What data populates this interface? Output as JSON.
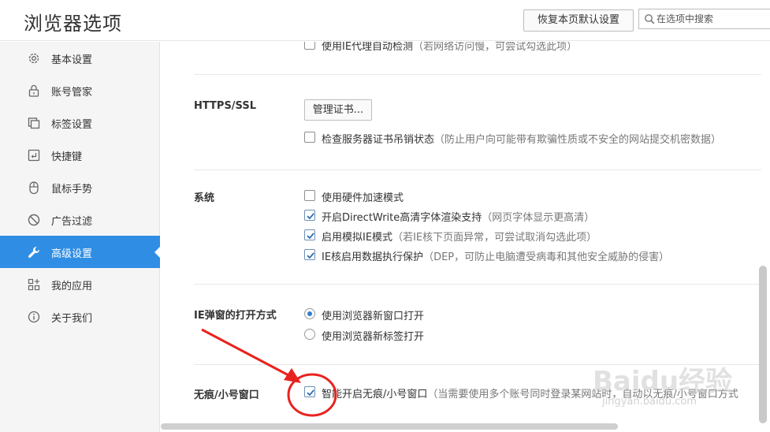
{
  "header": {
    "title": "浏览器选项",
    "reset_label": "恢复本页默认设置",
    "search_placeholder": "在选项中搜索"
  },
  "sidebar": {
    "items": [
      {
        "label": "基本设置",
        "icon": "gear-icon"
      },
      {
        "label": "账号管家",
        "icon": "lock-icon"
      },
      {
        "label": "标签设置",
        "icon": "tabs-icon"
      },
      {
        "label": "快捷键",
        "icon": "keyboard-icon"
      },
      {
        "label": "鼠标手势",
        "icon": "mouse-icon"
      },
      {
        "label": "广告过滤",
        "icon": "block-icon"
      },
      {
        "label": "高级设置",
        "icon": "wrench-icon",
        "active": true
      },
      {
        "label": "我的应用",
        "icon": "apps-icon"
      },
      {
        "label": "关于我们",
        "icon": "info-icon"
      }
    ],
    "active_color": "#2f8ee4"
  },
  "main": {
    "proxy": {
      "text": "使用IE代理自动检测",
      "hint": "（若网络访问慢，可尝试勾选此项）",
      "checked": false
    },
    "https": {
      "title": "HTTPS/SSL",
      "cert_button": "管理证书...",
      "check_revocation": {
        "text": "检查服务器证书吊销状态",
        "hint": "（防止用户向可能带有欺骗性质或不安全的网站提交机密数据）",
        "checked": false
      }
    },
    "system": {
      "title": "系统",
      "options": [
        {
          "text": "使用硬件加速模式",
          "hint": "",
          "checked": false
        },
        {
          "text": "开启DirectWrite高清字体渲染支持",
          "hint": "（网页字体显示更高清）",
          "checked": true
        },
        {
          "text": "启用模拟IE模式",
          "hint": "（若IE核下页面异常，可尝试取消勾选此项）",
          "checked": true
        },
        {
          "text": "IE核启用数据执行保护",
          "hint": "（DEP，可防止电脑遭受病毒和其他安全威胁的侵害）",
          "checked": true
        }
      ]
    },
    "ie_popup": {
      "title": "IE弹窗的打开方式",
      "options": [
        {
          "text": "使用浏览器新窗口打开",
          "selected": true
        },
        {
          "text": "使用浏览器新标签打开",
          "selected": false
        }
      ]
    },
    "incognito": {
      "title": "无痕/小号窗口",
      "option": {
        "text": "智能开启无痕/小号窗口",
        "hint": "（当需要使用多个账号同时登录某网站时，自动以无痕/小号窗口方式",
        "checked": true
      }
    }
  },
  "annotation": {
    "color": "#e8231f"
  },
  "watermark": {
    "brand": "Baidu经验",
    "url": "jingyan.baidu.com"
  }
}
